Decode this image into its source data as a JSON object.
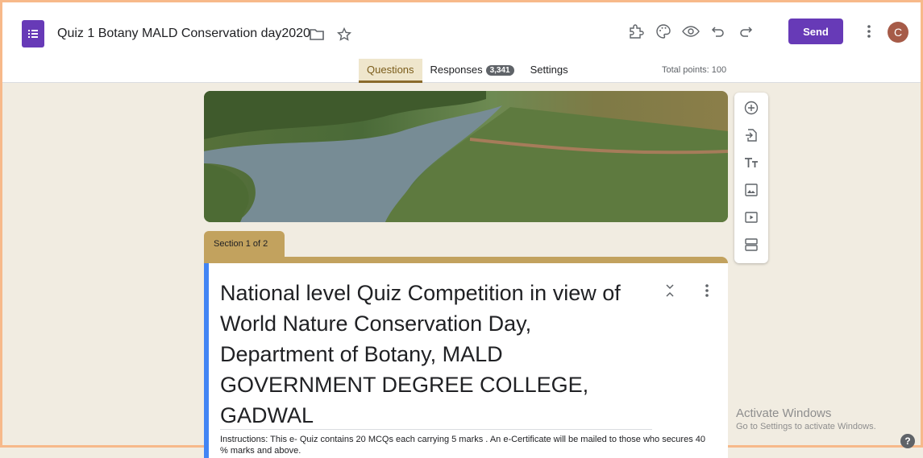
{
  "header": {
    "doc_title": "Quiz 1 Botany MALD Conservation day2020",
    "send_label": "Send",
    "avatar_initial": "C"
  },
  "tabs": [
    {
      "label": "Questions",
      "active": true
    },
    {
      "label": "Responses",
      "badge": "3,341"
    },
    {
      "label": "Settings"
    }
  ],
  "total_points": "Total points: 100",
  "section": {
    "label": "Section 1 of 2"
  },
  "form": {
    "title": "National level Quiz Competition in view of World Nature Conservation Day, Department of Botany, MALD GOVERNMENT DEGREE COLLEGE, GADWAL",
    "instructions": "Instructions: This e- Quiz contains 20 MCQs each carrying 5 marks . An e-Certificate will be mailed to those who secures 40 % marks and above."
  },
  "watermark": {
    "title": "Activate Windows",
    "subtitle": "Go to Settings to activate Windows."
  },
  "help_label": "?",
  "colors": {
    "theme": "#c2a25e",
    "brand": "#673ab7",
    "accent_bar": "#4285f4",
    "background": "#f1ece1"
  },
  "icons": {
    "header": [
      "folder-icon",
      "star-icon",
      "addon-puzzle-icon",
      "palette-icon",
      "preview-eye-icon",
      "undo-icon",
      "redo-icon",
      "more-vert-icon"
    ],
    "side_toolbar": [
      "add-question-icon",
      "import-questions-icon",
      "add-title-icon",
      "add-image-icon",
      "add-video-icon",
      "add-section-icon"
    ],
    "card": [
      "collapse-icon",
      "more-vert-icon"
    ]
  }
}
